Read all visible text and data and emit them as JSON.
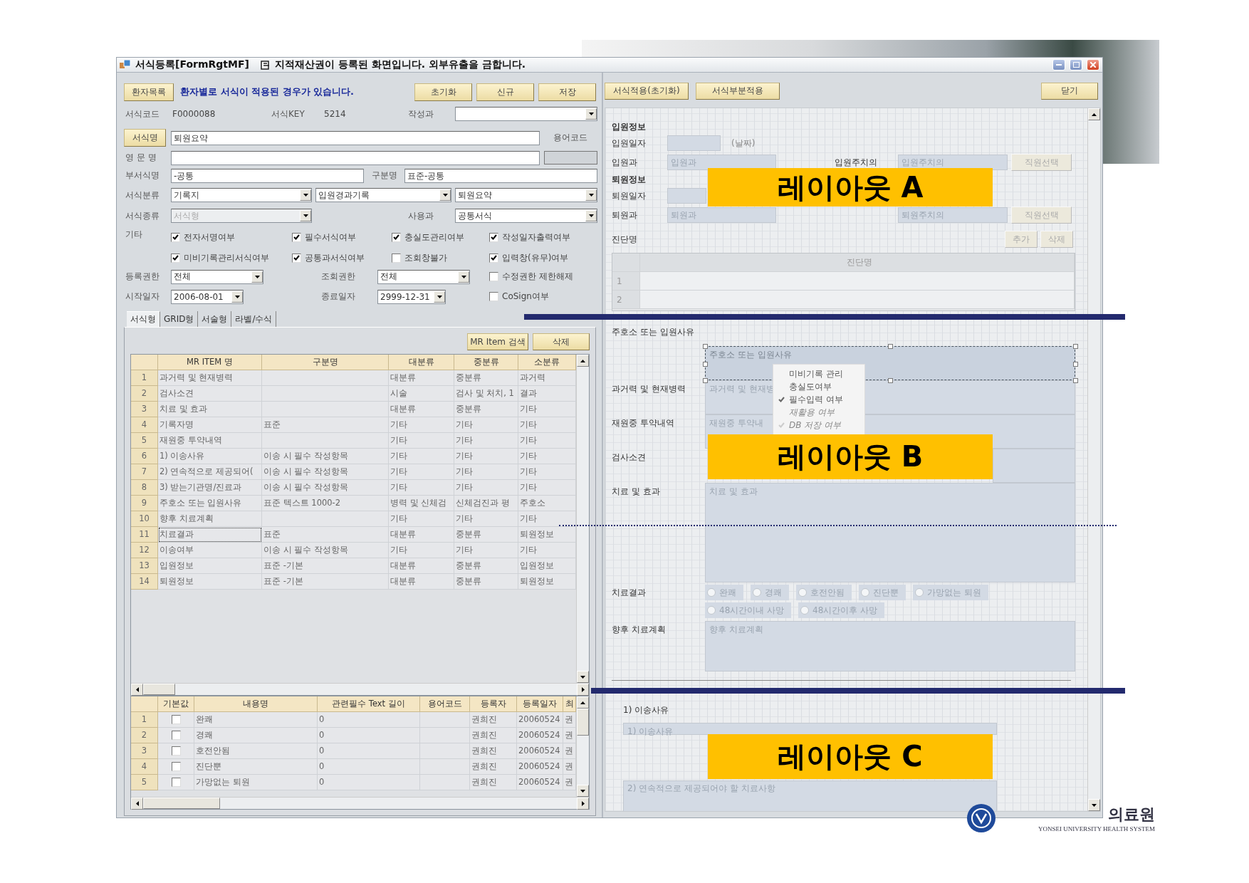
{
  "window": {
    "title": "서식등록[FormRgtMF]",
    "notice": "지적재산권이 등록된 화면입니다. 외부유출을 금합니다."
  },
  "form": {
    "patient_list_button": "환자목록",
    "message": "환자별로 서식이 적용된 경우가 있습니다.",
    "actions": [
      "초기화",
      "신규",
      "저장"
    ],
    "code": {
      "label": "서식코드",
      "value": "F0000088"
    },
    "key": {
      "label": "서식KEY",
      "value": "5214"
    },
    "writing_dept": {
      "label": "작성과"
    },
    "name": {
      "button": "서식명",
      "value": "퇴원요약"
    },
    "term_code": {
      "label": "용어코드"
    },
    "english_name": {
      "label": "영 문 명"
    },
    "sub_name": {
      "label": "부서식명",
      "value": "-공통"
    },
    "division": {
      "label": "구분명",
      "value": "표준-공통"
    },
    "category": {
      "label": "서식분류",
      "values": [
        "기록지",
        "입원경과기록",
        "퇴원요약"
      ]
    },
    "type": {
      "label": "서식종류",
      "value": "서식형",
      "disabled": true
    },
    "using_dept": {
      "label": "사용과",
      "value": "공통서식"
    },
    "etc_label": "기타",
    "options": [
      {
        "label": "전자서명여부",
        "checked": true
      },
      {
        "label": "필수서식여부",
        "checked": true
      },
      {
        "label": "충실도관리여부",
        "checked": true
      },
      {
        "label": "작성일자출력여부",
        "checked": true
      },
      {
        "label": "미비기록관리서식여부",
        "checked": true
      },
      {
        "label": "공통과서식여부",
        "checked": true
      },
      {
        "label": "조회창불가",
        "checked": false
      },
      {
        "label": "입력창(유무)여부",
        "checked": true
      }
    ],
    "register_auth": {
      "label": "등록권한",
      "value": "전체"
    },
    "view_auth": {
      "label": "조회권한",
      "value": "전체"
    },
    "edit_unlock": {
      "label": "수정권한 제한해제",
      "checked": false
    },
    "start_date": {
      "label": "시작일자",
      "value": "2006-08-01"
    },
    "end_date": {
      "label": "종료일자",
      "value": "2999-12-31"
    },
    "cosign": {
      "label": "CoSign여부",
      "checked": false
    }
  },
  "tabs": [
    {
      "label": "서식형",
      "selected": true
    },
    {
      "label": "GRID형",
      "selected": false
    },
    {
      "label": "서술형",
      "selected": false
    },
    {
      "label": "라벨/수식",
      "selected": false
    }
  ],
  "item_toolbar": [
    "MR Item 검색",
    "삭제"
  ],
  "item_table": {
    "columns": [
      "MR ITEM 명",
      "구분명",
      "대분류",
      "중분류",
      "소분류"
    ],
    "rows": [
      {
        "number": "1",
        "item_name": "과거력 및 현재병력",
        "major": "대분류",
        "middle": "중분류",
        "minor": "과거력",
        "selected": false
      },
      {
        "number": "2",
        "item_name": "검사소견",
        "major": "시술",
        "middle": "검사 및 처치, 1",
        "minor": "결과",
        "selected": false
      },
      {
        "number": "3",
        "item_name": "치료 및 효과",
        "major": "대분류",
        "middle": "중분류",
        "minor": "기타",
        "selected": false
      },
      {
        "number": "4",
        "item_name": "기록자명",
        "division": "표준",
        "major": "기타",
        "middle": "기타",
        "minor": "기타",
        "selected": false
      },
      {
        "number": "5",
        "item_name": "재원중 투약내역",
        "major": "기타",
        "middle": "기타",
        "minor": "기타",
        "selected": false
      },
      {
        "number": "6",
        "item_name": "1) 이송사유",
        "division": "이송 시 필수 작성항목",
        "major": "기타",
        "middle": "기타",
        "minor": "기타",
        "selected": false
      },
      {
        "number": "7",
        "item_name": "2) 연속적으로 제공되어(",
        "division": "이송 시 필수 작성항목",
        "major": "기타",
        "middle": "기타",
        "minor": "기타",
        "selected": false
      },
      {
        "number": "8",
        "item_name": "3) 받는기관명/진료과",
        "division": "이송 시 필수 작성항목",
        "major": "기타",
        "middle": "기타",
        "minor": "기타",
        "selected": false
      },
      {
        "number": "9",
        "item_name": "주호소 또는 입원사유",
        "division": "표준  텍스트 1000-2",
        "major": "병력 및 신체검",
        "middle": "신체검진과 평",
        "minor": "주호소",
        "selected": false
      },
      {
        "number": "10",
        "item_name": "향후 치료계획",
        "major": "기타",
        "middle": "기타",
        "minor": "기타",
        "selected": false
      },
      {
        "number": "11",
        "item_name": "치료결과",
        "division": "표준",
        "major": "대분류",
        "middle": "중분류",
        "minor": "퇴원정보",
        "selected": true
      },
      {
        "number": "12",
        "item_name": "이송여부",
        "division": "이송 시 필수 작성항목",
        "major": "기타",
        "middle": "기타",
        "minor": "기타",
        "selected": false
      },
      {
        "number": "13",
        "item_name": "입원정보",
        "division": "표준 -기본",
        "major": "대분류",
        "middle": "중분류",
        "minor": "입원정보",
        "selected": false
      },
      {
        "number": "14",
        "item_name": "퇴원정보",
        "division": "표준 -기본",
        "major": "대분류",
        "middle": "중분류",
        "minor": "퇴원정보",
        "selected": false
      }
    ]
  },
  "content_table": {
    "columns": [
      "기본값",
      "내용명",
      "관련필수  Text 길이",
      "용어코드",
      "등록자",
      "등록일자",
      "최"
    ],
    "rows": [
      {
        "number": "1",
        "default": false,
        "name": "완쾌",
        "text_length": "0",
        "registrant": "권희진",
        "date": "20060524",
        "column_8": "권"
      },
      {
        "number": "2",
        "default": false,
        "name": "경쾌",
        "text_length": "0",
        "registrant": "권희진",
        "date": "20060524",
        "column_8": "권"
      },
      {
        "number": "3",
        "default": false,
        "name": "호전안됨",
        "text_length": "0",
        "registrant": "권희진",
        "date": "20060524",
        "column_8": "권"
      },
      {
        "number": "4",
        "default": false,
        "name": "진단뿐",
        "text_length": "0",
        "registrant": "권희진",
        "date": "20060524",
        "column_8": "권"
      },
      {
        "number": "5",
        "default": false,
        "name": "가망없는 퇴원",
        "text_length": "0",
        "registrant": "권희진",
        "date": "20060524",
        "column_8": "권"
      }
    ]
  },
  "designer": {
    "actions": [
      "서식적용(초기화)",
      "서식부분적용"
    ],
    "close": "닫기",
    "admission": {
      "heading": "입원정보",
      "date_label": "입원일자",
      "date_hint": "(날짜)",
      "dept_label": "입원과",
      "dept_value": "입원과",
      "doctor_label": "입원주치의",
      "doctor_value": "입원주치의",
      "staff_button": "직원선택"
    },
    "discharge": {
      "heading": "퇴원정보",
      "date_label": "퇴원일자",
      "dept_label": "퇴원과",
      "dept_value": "퇴원과",
      "doctor_value": "퇴원주치의",
      "staff_button": "직원선택"
    },
    "diagnosis": {
      "label": "진단명",
      "buttons": [
        "추가",
        "삭제"
      ],
      "column": "진단명",
      "rows": [
        "1",
        "2"
      ]
    },
    "complaint_label": "주호소 또는 입원사유",
    "fields": [
      {
        "text": "주호소 또는 입원사유",
        "kind": "single",
        "selected": true
      },
      {
        "label": "과거력 및 현재병력",
        "text": "과거력 및 현재병",
        "kind": "single",
        "selected": false
      },
      {
        "label": "재원중 투약내역",
        "text": "재원중 투약내",
        "kind": "single",
        "selected": false
      },
      {
        "label": "검사소견",
        "kind": "single",
        "selected": false
      },
      {
        "label": "치료 및 효과",
        "text": "치료 및 효과",
        "kind": "large",
        "selected": false
      }
    ],
    "context_menu": [
      {
        "label": "미비기록 관리",
        "checked": false,
        "disabled": false
      },
      {
        "label": "충실도여부",
        "checked": false,
        "disabled": false
      },
      {
        "label": "필수입력 여부",
        "checked": true,
        "disabled": false
      },
      {
        "label": "재활용 여부",
        "checked": false,
        "disabled": true
      },
      {
        "label": "DB 저장 여부",
        "checked": true,
        "disabled": true
      }
    ],
    "result": {
      "label": "치료결과",
      "options": [
        {
          "label": "완쾌",
          "selected": false
        },
        {
          "label": "경쾌",
          "selected": false
        },
        {
          "label": "호전안됨",
          "selected": false
        },
        {
          "label": "진단뿐",
          "selected": false
        },
        {
          "label": "가망없는 퇴원",
          "selected": false
        },
        {
          "label": "48시간이내 사망",
          "selected": false
        },
        {
          "label": "48시간이후 사망",
          "selected": false
        }
      ]
    },
    "plan": {
      "label": "향후 치료계획",
      "text": "향후 치료계획"
    },
    "transfer": {
      "label": "1) 이송사유",
      "boxes": [
        "1) 이송사유",
        "2) 연속적으로 제공되어야 할 치료사항"
      ]
    }
  },
  "slide": {
    "labels": [
      "레이아웃 A",
      "레이아웃 B",
      "레이아웃 C"
    ],
    "logo": {
      "name": "의료원",
      "subtitle": "YONSEI UNIVERSITY HEALTH SYSTEM"
    }
  }
}
